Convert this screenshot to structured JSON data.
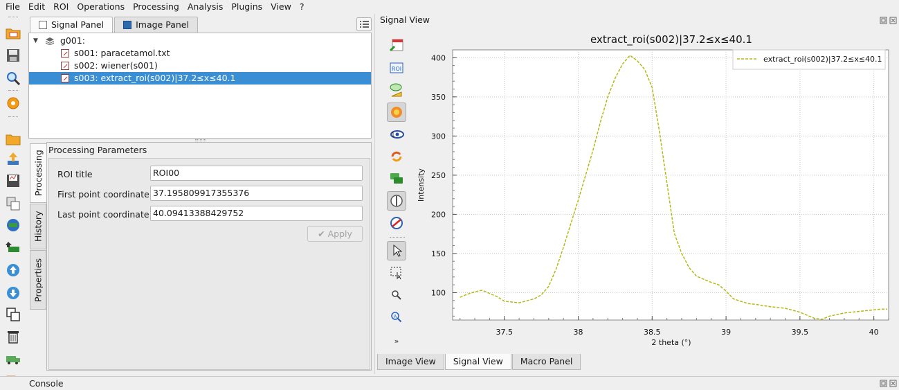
{
  "menu": [
    "File",
    "Edit",
    "ROI",
    "Operations",
    "Processing",
    "Analysis",
    "Plugins",
    "View",
    "?"
  ],
  "left_panel": {
    "tabs": [
      {
        "label": "Signal Panel",
        "active": true
      },
      {
        "label": "Image Panel",
        "active": false
      }
    ],
    "tree": {
      "group": "g001:",
      "items": [
        {
          "label": "s001: paracetamol.txt",
          "selected": false
        },
        {
          "label": "s002: wiener(s001)",
          "selected": false
        },
        {
          "label": "s003: extract_roi(s002)|37.2≤x≤40.1",
          "selected": true
        }
      ]
    },
    "side_tabs": [
      "Processing",
      "History",
      "Properties"
    ],
    "params": {
      "title": "Processing Parameters",
      "fields": [
        {
          "label": "ROI title",
          "value": "ROI00"
        },
        {
          "label": "First point coordinate",
          "value": "37.195809917355376"
        },
        {
          "label": "Last point coordinate",
          "value": "40.09413388429752"
        }
      ],
      "apply_label": "Apply"
    }
  },
  "signal_view": {
    "dock_title": "Signal View",
    "bottom_tabs": [
      {
        "label": "Image View",
        "active": false
      },
      {
        "label": "Signal View",
        "active": true
      },
      {
        "label": "Macro Panel",
        "active": false
      }
    ]
  },
  "console_title": "Console",
  "colors": {
    "selection": "#3a8ed4",
    "curve": "#b5b815"
  },
  "chart_data": {
    "type": "line",
    "title": "extract_roi(s002)|37.2≤x≤40.1",
    "xlabel": "2 theta (°)",
    "ylabel": "Intensity",
    "xlim": [
      37.15,
      40.1
    ],
    "ylim": [
      65,
      410
    ],
    "xticks": [
      37.5,
      38,
      38.5,
      39,
      39.5,
      40
    ],
    "yticks": [
      100,
      150,
      200,
      250,
      300,
      350,
      400
    ],
    "grid": true,
    "legend": "top-right",
    "series": [
      {
        "name": "extract_roi(s002)|37.2≤x≤40.1",
        "line_style": "dashed",
        "x": [
          37.2,
          37.25,
          37.3,
          37.35,
          37.4,
          37.45,
          37.5,
          37.6,
          37.7,
          37.75,
          37.8,
          37.85,
          37.9,
          37.95,
          38.0,
          38.05,
          38.1,
          38.15,
          38.2,
          38.25,
          38.3,
          38.35,
          38.4,
          38.45,
          38.5,
          38.55,
          38.6,
          38.65,
          38.7,
          38.75,
          38.8,
          38.85,
          38.9,
          38.95,
          39.0,
          39.05,
          39.1,
          39.15,
          39.2,
          39.3,
          39.4,
          39.5,
          39.55,
          39.6,
          39.65,
          39.7,
          39.75,
          39.8,
          39.85,
          39.9,
          39.95,
          40.0,
          40.05,
          40.09
        ],
        "y": [
          94,
          98,
          101,
          103,
          99,
          95,
          89,
          87,
          92,
          97,
          108,
          130,
          158,
          188,
          218,
          250,
          282,
          318,
          350,
          374,
          392,
          403,
          396,
          385,
          362,
          305,
          240,
          176,
          150,
          132,
          121,
          117,
          113,
          110,
          102,
          92,
          89,
          86,
          85,
          82,
          80,
          75,
          71,
          67,
          66,
          70,
          72,
          74,
          75,
          76,
          77,
          78,
          79,
          79
        ]
      }
    ]
  }
}
